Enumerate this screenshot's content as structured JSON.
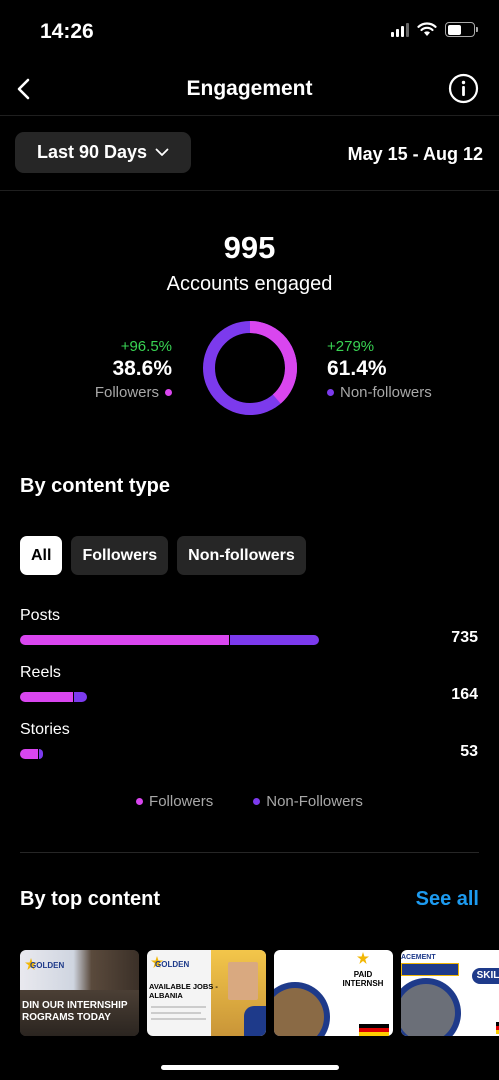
{
  "status_bar": {
    "time": "14:26"
  },
  "nav": {
    "title": "Engagement"
  },
  "filter": {
    "range_label": "Last 90 Days",
    "date_range": "May 15 - Aug 12"
  },
  "summary": {
    "total": "995",
    "total_label": "Accounts engaged",
    "followers": {
      "change": "+96.5%",
      "percent": "38.6%",
      "label": "Followers",
      "fraction": 0.386
    },
    "non_followers": {
      "change": "+279%",
      "percent": "61.4%",
      "label": "Non-followers",
      "fraction": 0.614
    }
  },
  "content_type": {
    "title": "By content type",
    "tabs": [
      {
        "label": "All",
        "active": true
      },
      {
        "label": "Followers",
        "active": false
      },
      {
        "label": "Non-followers",
        "active": false
      }
    ],
    "rows": [
      {
        "label": "Posts",
        "value": "735",
        "total": 735,
        "followers_fraction": 0.7
      },
      {
        "label": "Reels",
        "value": "164",
        "total": 164,
        "followers_fraction": 0.8
      },
      {
        "label": "Stories",
        "value": "53",
        "total": 53,
        "followers_fraction": 0.85
      }
    ],
    "legend": {
      "followers": "Followers",
      "non_followers": "Non-Followers"
    }
  },
  "top_content": {
    "title": "By top content",
    "see_all": "See all",
    "thumbs": [
      {
        "brand": "GOLDEN",
        "caption": "DIN OUR INTERNSHIP\nROGRAMS TODAY"
      },
      {
        "brand": "GOLDEN",
        "caption": "AVAILABLE JOBS -\nALBANIA"
      },
      {
        "brand": "",
        "caption": "PAID\nINTERNSH"
      },
      {
        "brand": "ACEMENT",
        "caption": "SKILLED"
      }
    ]
  },
  "colors": {
    "followers": "#d946ef",
    "non_followers": "#7c3aed",
    "accent": "#1d9bf0",
    "positive": "#39d353"
  }
}
